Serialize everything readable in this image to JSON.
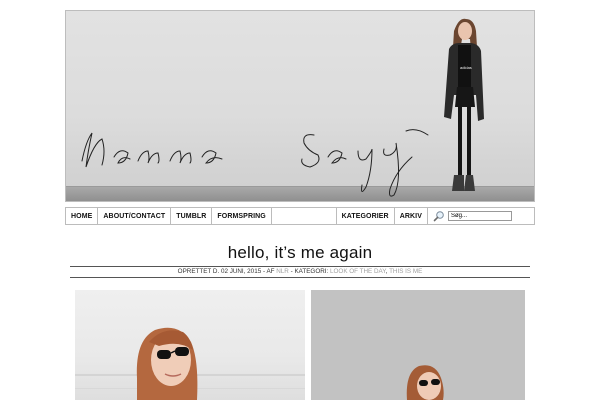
{
  "header": {
    "blog_title": "Nanna Says"
  },
  "nav": {
    "left_items": [
      "HOME",
      "ABOUT/CONTACT",
      "TUMBLR",
      "FORMSPRING"
    ],
    "right_items": [
      "KATEGORIER",
      "ARKIV"
    ],
    "search_value": "Søg..."
  },
  "post": {
    "title": "hello, it’s me again",
    "meta_prefix": "OPRETTET D. 02 JUNI, 2015 - AF ",
    "author": "NLR",
    "meta_mid": " - KATEGORI: ",
    "category1": "LOOK OF THE DAY",
    "meta_sep": ", ",
    "category2": "THIS IS ME"
  },
  "colors": {
    "link_gray": "#a0a0a0",
    "border": "#bcbcbc"
  },
  "icons": {
    "search": "magnifier-icon"
  }
}
